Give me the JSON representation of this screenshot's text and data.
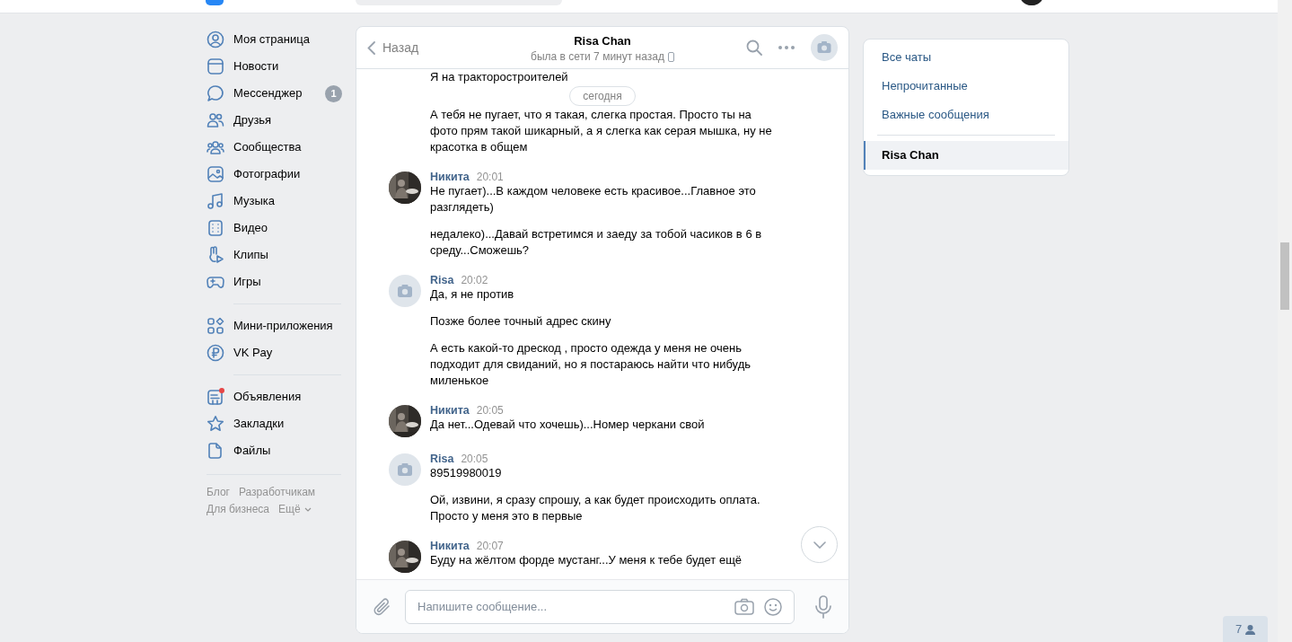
{
  "nav": {
    "groups": [
      {
        "items": [
          {
            "label": "Моя страница"
          },
          {
            "label": "Новости"
          },
          {
            "label": "Мессенджер",
            "badge": "1"
          },
          {
            "label": "Друзья"
          },
          {
            "label": "Сообщества"
          },
          {
            "label": "Фотографии"
          },
          {
            "label": "Музыка"
          },
          {
            "label": "Видео"
          },
          {
            "label": "Клипы"
          },
          {
            "label": "Игры"
          }
        ]
      },
      {
        "items": [
          {
            "label": "Мини-приложения"
          },
          {
            "label": "VK Pay"
          }
        ]
      },
      {
        "items": [
          {
            "label": "Объявления",
            "notification": true
          },
          {
            "label": "Закладки"
          },
          {
            "label": "Файлы"
          }
        ]
      }
    ],
    "footer_links": [
      {
        "label": "Блог"
      },
      {
        "label": "Разработчикам"
      },
      {
        "label": "Для бизнеса"
      },
      {
        "label": "Ещё",
        "dropdown": true
      }
    ]
  },
  "chat": {
    "back": "Назад",
    "title": "Risa Chan",
    "status": "была в сети 7 минут назад",
    "date_divider": "сегодня",
    "messages": [
      {
        "texts": [
          "Я на тракторостроителей"
        ]
      },
      {
        "texts": [
          "А тебя не пугает, что я такая, слегка простая. Просто ты на фото прям такой шикарный, а я слегка как серая мышка, ну не красотка в общем"
        ]
      },
      {
        "author": "Никита",
        "time": "20:01",
        "texts": [
          "Не пугает)...В каждом человеке есть красивое...Главное это разглядеть)",
          "недалеко)...Давай встретимся и заеду за тобой часиков в 6 в среду...Сможешь?"
        ]
      },
      {
        "author": "Risa",
        "time": "20:02",
        "kind": "placeholder",
        "texts": [
          "Да, я не против",
          "Позже более точный адрес скину",
          "А есть какой-то дрескод , просто одежда у меня не очень подходит для свиданий, но я постараюсь найти что нибудь миленькое"
        ]
      },
      {
        "author": "Никита",
        "time": "20:05",
        "texts": [
          "Да нет...Одевай что хочешь)...Номер черкани свой"
        ]
      },
      {
        "author": "Risa",
        "time": "20:05",
        "kind": "placeholder",
        "texts": [
          "89519980019",
          "Ой, извини, я сразу спрошу, а как будет происходить оплата. Просто у меня это в первые"
        ]
      },
      {
        "author": "Никита",
        "time": "20:07",
        "texts": [
          "Буду на жёлтом форде мустанг...У меня к тебе будет ещё"
        ]
      }
    ],
    "composer": {
      "placeholder": "Напишите сообщение..."
    }
  },
  "folders": {
    "items": [
      {
        "label": "Все чаты",
        "selected": false
      },
      {
        "label": "Непрочитанные",
        "selected": false
      },
      {
        "label": "Важные сообщения",
        "selected": false
      }
    ],
    "chats": [
      {
        "label": "Risa Chan",
        "selected": true
      }
    ]
  },
  "online_badge": "7"
}
